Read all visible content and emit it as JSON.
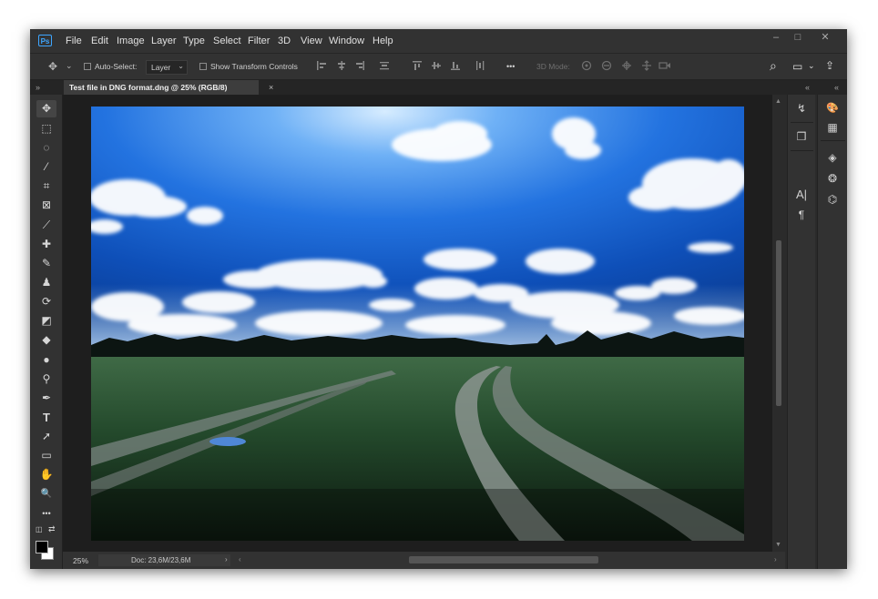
{
  "app": {
    "logo": "Ps"
  },
  "menu": [
    "File",
    "Edit",
    "Image",
    "Layer",
    "Type",
    "Select",
    "Filter",
    "3D",
    "View",
    "Window",
    "Help"
  ],
  "window_controls": {
    "minimize": "–",
    "maximize": "□",
    "close": "✕"
  },
  "options": {
    "move_glyph": "✥",
    "chevron": "⌄",
    "auto_select_label": "Auto-Select:",
    "layer_value": "Layer",
    "show_transform_label": "Show Transform Controls",
    "more_glyph": "•••",
    "mode_3d_label": "3D Mode:",
    "search_glyph": "⌕",
    "workspace_glyph": "▭",
    "share_glyph": "⇪"
  },
  "tab": {
    "title": "Test file in DNG format.dng @ 25% (RGB/8)",
    "close": "×"
  },
  "collapse_glyph": "»",
  "collapse_right_glyph": "«",
  "tools": [
    {
      "name": "move-tool",
      "glyph": "✥"
    },
    {
      "name": "marquee-tool",
      "glyph": "⬚"
    },
    {
      "name": "lasso-tool",
      "glyph": "◌"
    },
    {
      "name": "quick-select-tool",
      "glyph": "⁄"
    },
    {
      "name": "crop-tool",
      "glyph": "⌗"
    },
    {
      "name": "frame-tool",
      "glyph": "⊠"
    },
    {
      "name": "eyedropper-tool",
      "glyph": "⟋"
    },
    {
      "name": "healing-brush-tool",
      "glyph": "✚"
    },
    {
      "name": "brush-tool",
      "glyph": "✎"
    },
    {
      "name": "clone-stamp-tool",
      "glyph": "♟"
    },
    {
      "name": "history-brush-tool",
      "glyph": "⟳"
    },
    {
      "name": "eraser-tool",
      "glyph": "◩"
    },
    {
      "name": "paint-bucket-tool",
      "glyph": "◆"
    },
    {
      "name": "blur-tool",
      "glyph": "●"
    },
    {
      "name": "dodge-tool",
      "glyph": "⚲"
    },
    {
      "name": "pen-tool",
      "glyph": "✒"
    },
    {
      "name": "type-tool",
      "glyph": "T"
    },
    {
      "name": "path-selection-tool",
      "glyph": "➚"
    },
    {
      "name": "rectangle-tool",
      "glyph": "▭"
    },
    {
      "name": "hand-tool",
      "glyph": "✋"
    },
    {
      "name": "zoom-tool",
      "glyph": "🔍"
    },
    {
      "name": "more-tools",
      "glyph": "•••"
    }
  ],
  "color_swap_glyph": "⇄",
  "default_colors_glyph": "◫",
  "colors": {
    "foreground": "#000000",
    "background": "#ffffff"
  },
  "status": {
    "zoom": "25%",
    "doc": "Doc: 23,6M/23,6M",
    "arrow": "›",
    "scroll_left": "‹",
    "scroll_right": "›",
    "scroll_up": "▲",
    "scroll_down": "▼"
  },
  "panel1_icons": [
    {
      "name": "history-panel-icon",
      "glyph": "↯"
    },
    {
      "name": "3d-panel-icon",
      "glyph": "❒"
    },
    {
      "name": "character-panel-icon",
      "glyph": "A|"
    },
    {
      "name": "paragraph-panel-icon",
      "glyph": "¶"
    }
  ],
  "panel2_icons": [
    {
      "name": "color-panel-icon",
      "glyph": "🎨"
    },
    {
      "name": "swatches-panel-icon",
      "glyph": "▦"
    },
    {
      "name": "layers-panel-icon",
      "glyph": "◈"
    },
    {
      "name": "channels-panel-icon",
      "glyph": "❂"
    },
    {
      "name": "paths-panel-icon",
      "glyph": "⌬"
    }
  ]
}
